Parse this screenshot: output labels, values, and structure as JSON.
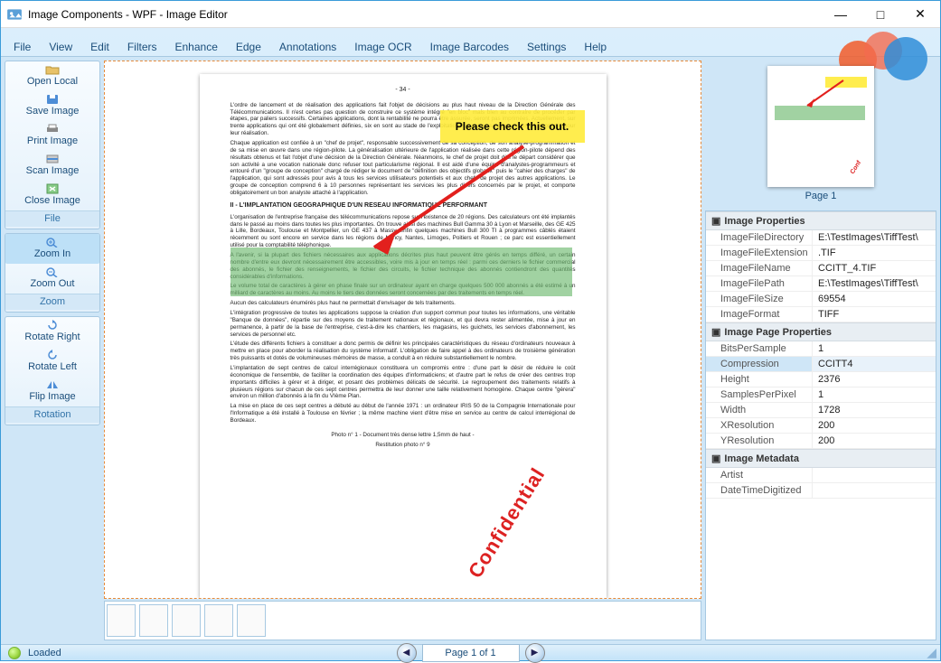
{
  "window": {
    "title": "Image Components - WPF - Image Editor"
  },
  "menu": [
    "File",
    "View",
    "Edit",
    "Filters",
    "Enhance",
    "Edge",
    "Annotations",
    "Image OCR",
    "Image Barcodes",
    "Settings",
    "Help"
  ],
  "sidebar": {
    "file": {
      "label": "File",
      "items": [
        {
          "label": "Open Local",
          "name": "open-local"
        },
        {
          "label": "Save Image",
          "name": "save-image"
        },
        {
          "label": "Print Image",
          "name": "print-image"
        },
        {
          "label": "Scan Image",
          "name": "scan-image"
        },
        {
          "label": "Close Image",
          "name": "close-image"
        }
      ]
    },
    "zoom": {
      "label": "Zoom",
      "items": [
        {
          "label": "Zoom In",
          "name": "zoom-in"
        },
        {
          "label": "Zoom Out",
          "name": "zoom-out"
        }
      ]
    },
    "rot": {
      "label": "Rotation",
      "items": [
        {
          "label": "Rotate Right",
          "name": "rotate-right"
        },
        {
          "label": "Rotate Left",
          "name": "rotate-left"
        },
        {
          "label": "Flip Image",
          "name": "flip-image"
        }
      ]
    }
  },
  "doc": {
    "pageNumber": "- 34 -",
    "para1": "L'ordre de lancement et de réalisation des applications fait l'objet de décisions au plus haut niveau de la Direction Générale des Télécommunications. Il n'est certes pas question de construire ce système intégré \"en bloc\" mais bien au contraire de procéder par étapes, par paliers successifs. Certaines applications, dont la rentabilité ne pourra être assurée, seront pas imprimées. Actuellement, sur trente applications qui ont été globalement définies, six en sont au stade de l'exploitation, six autres se sont vu donner la priorité pour leur réalisation.",
    "para2": "Chaque application est confiée à un \"chef de projet\", responsable successivement de sa conception, de son analyse-programmation et de sa mise en œuvre dans une région-pilote. La généralisation ultérieure de l'application réalisée dans cette région-pilote dépend des résultats obtenus et fait l'objet d'une décision de la Direction Générale. Néanmoins, le chef de projet doit dès le départ considérer que son activité a une vocation nationale donc refuser tout particularisme régional. Il est aidé d'une équipe d'analystes-programmeurs et entouré d'un \"groupe de conception\" chargé de rédiger le document de \"définition des objectifs globaux\" puis le \"cahier des charges\" de l'application, qui sont adressés pour avis à tous les services utilisateurs potentiels et aux chefs de projet des autres applications. Le groupe de conception comprend 6 à 10 personnes représentant les services les plus divers concernés par le projet, et comporte obligatoirement un bon analyste attaché à l'application.",
    "heading": "II - L'IMPLANTATION GEOGRAPHIQUE D'UN RESEAU INFORMATIQUE PERFORMANT",
    "para3": "L'organisation de l'entreprise française des télécommunications repose sur l'existence de 20 régions. Des calculateurs ont été implantés dans le passé au moins dans toutes les plus importantes. On trouve ainsi des machines Bull Gamma 30 à Lyon et Marseille, des GE 425 à Lille, Bordeaux, Toulouse et Montpellier, un GE 437 à Massy, enfin quelques machines Bull 300 TI à programmes câblés étaient récemment ou sont encore en service dans les régions de Nancy, Nantes, Limoges, Poitiers et Rouen ; ce parc est essentiellement utilisé pour la comptabilité téléphonique.",
    "para4": "A l'avenir, si la plupart des fichiers nécessaires aux applications décrites plus haut peuvent être gérés en temps différé, un certain nombre d'entre eux devront nécessairement être accessibles, voire mis à jour en temps réel : parmi ces derniers le fichier commercial des abonnés, le fichier des renseignements, le fichier des circuits, le fichier technique des abonnés contiendront des quantités considérables d'informations.",
    "para5": "Le volume total de caractères à gérer en phase finale sur un ordinateur ayant en charge quelques 500 000 abonnés a été estimé à un milliard de caractères au moins. Au moins le tiers des données seront concernées par des traitements en temps réel.",
    "para6": "Aucun des calculateurs énumérés plus haut ne permettait d'envisager de tels traitements.",
    "para7": "L'intégration progressive de toutes les applications suppose la création d'un support commun pour toutes les informations, une véritable \"Banque de données\", répartie sur des moyens de traitement nationaux et régionaux, et qui devra rester alimentée, mise à jour en permanence, à partir de la base de l'entreprise, c'est-à-dire les chantiers, les magasins, les guichets, les services d'abonnement, les services de personnel etc.",
    "para8": "L'étude des différents fichiers à constituer a donc permis de définir les principales caractéristiques du réseau d'ordinateurs nouveaux à mettre en place pour aborder la réalisation du système informatif. L'obligation de faire appel à des ordinateurs de troisième génération très puissants et dotés de volumineuses mémoires de masse, a conduit à en réduire substantiellement le nombre.",
    "para9": "L'implantation de sept centres de calcul interrégionaux constituera un compromis entre : d'une part le désir de réduire le coût économique de l'ensemble, de faciliter la coordination des équipes d'informaticiens; et d'autre part le refus de créer des centres trop importants difficiles à gérer et à diriger, et posant des problèmes délicats de sécurité. Le regroupement des traitements relatifs à plusieurs régions sur chacun de ces sept centres permettra de leur donner une taille relativement homogène. Chaque centre \"gérera\" environ un million d'abonnés à la fin du VIème Plan.",
    "para10": "La mise en place de ces sept centres a débuté au début de l'année 1971 : un ordinateur IRIS 50 de la Compagnie Internationale pour l'Informatique a été installé à Toulouse en février ; la même machine vient d'être mise en service au centre de calcul interrégional de Bordeaux.",
    "caption1": "Photo n° 1 - Document très dense lettre 1,5mm de haut -",
    "caption2": "Restitution photo n° 9",
    "noteText": "Please check this out.",
    "stamp": "Confidential"
  },
  "thumb": {
    "caption": "Page 1"
  },
  "props": {
    "g1": "Image Properties",
    "g1rows": [
      {
        "k": "ImageFileDirectory",
        "v": "E:\\TestImages\\TiffTest\\"
      },
      {
        "k": "ImageFileExtension",
        "v": ".TIF"
      },
      {
        "k": "ImageFileName",
        "v": "CCITT_4.TIF"
      },
      {
        "k": "ImageFilePath",
        "v": "E:\\TestImages\\TiffTest\\"
      },
      {
        "k": "ImageFileSize",
        "v": "69554"
      },
      {
        "k": "ImageFormat",
        "v": "TIFF"
      }
    ],
    "g2": "Image Page Properties",
    "g2rows": [
      {
        "k": "BitsPerSample",
        "v": "1"
      },
      {
        "k": "Compression",
        "v": "CCITT4",
        "sel": true
      },
      {
        "k": "Height",
        "v": "2376"
      },
      {
        "k": "SamplesPerPixel",
        "v": "1"
      },
      {
        "k": "Width",
        "v": "1728"
      },
      {
        "k": "XResolution",
        "v": "200"
      },
      {
        "k": "YResolution",
        "v": "200"
      }
    ],
    "g3": "Image Metadata",
    "g3rows": [
      {
        "k": "Artist",
        "v": ""
      },
      {
        "k": "DateTimeDigitized",
        "v": ""
      }
    ]
  },
  "status": {
    "text": "Loaded",
    "pager": "Page 1 of 1"
  }
}
